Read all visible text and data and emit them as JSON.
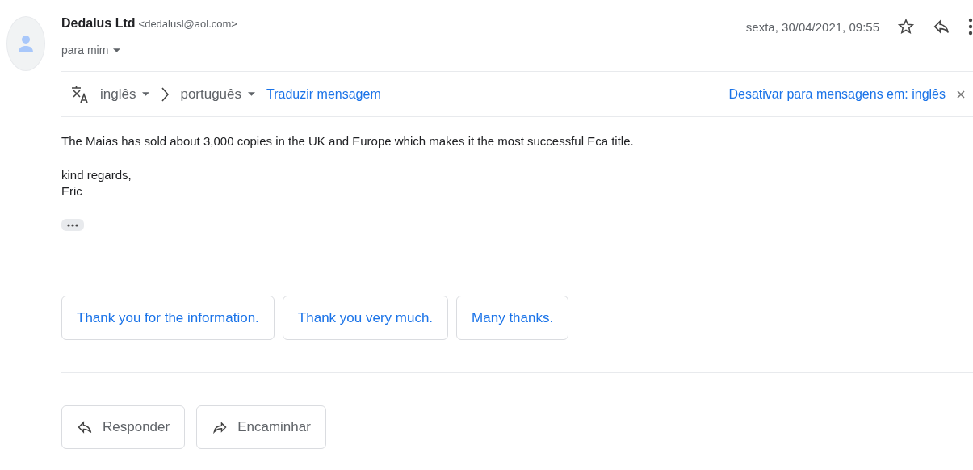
{
  "sender": {
    "name": "Dedalus Ltd",
    "email": "<dedalusl@aol.com>",
    "recipient": "para mim"
  },
  "date": "sexta, 30/04/2021, 09:55",
  "translate_bar": {
    "from": "inglês",
    "to": "português",
    "action": "Traduzir mensagem",
    "disable": "Desativar para mensagens em: inglês"
  },
  "body": {
    "paragraphs": [
      "The Maias has sold about 3,000 copies in the UK and Europe which makes it the most successful Eca title."
    ],
    "signoff": [
      "kind regards,",
      "Eric"
    ]
  },
  "smart_replies": [
    "Thank you for the information.",
    "Thank you very much.",
    "Many thanks."
  ],
  "actions": [
    {
      "kind": "reply",
      "label": "Responder"
    },
    {
      "kind": "forward",
      "label": "Encaminhar"
    }
  ]
}
